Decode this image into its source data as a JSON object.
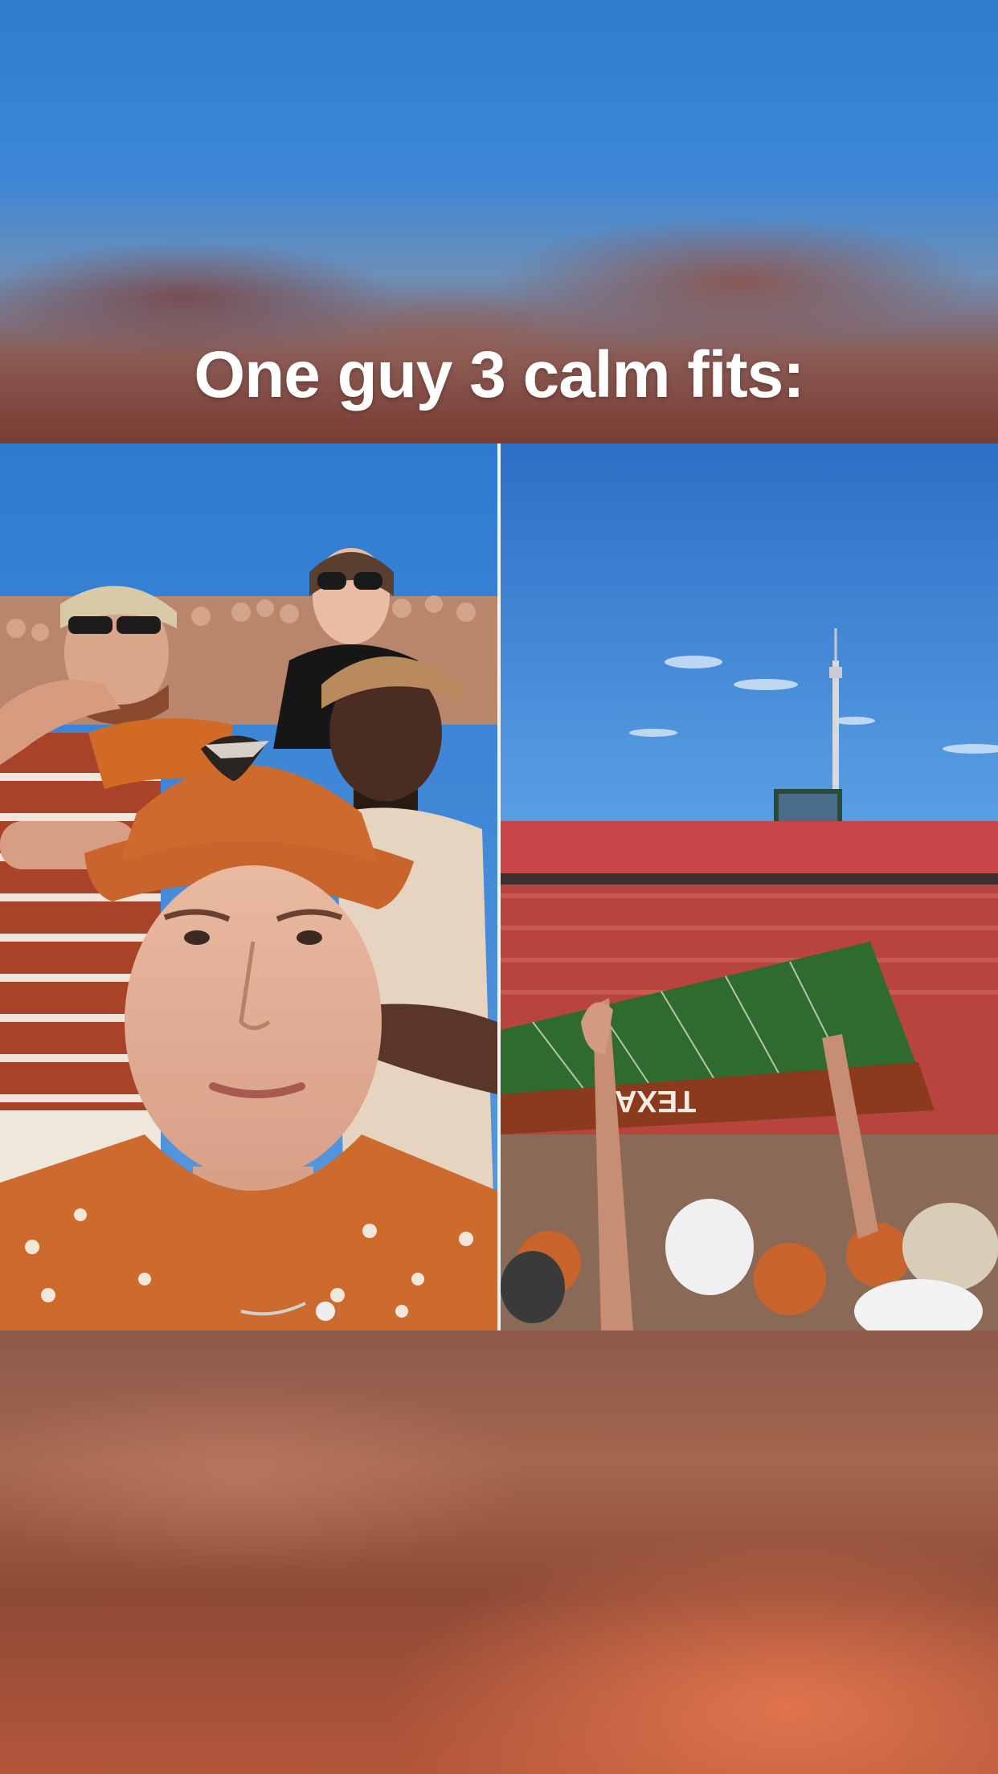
{
  "caption": "One guy 3 calm fits:",
  "photos": [
    {
      "subject": "selfie-in-stands"
    },
    {
      "subject": "stadium-field-view"
    }
  ],
  "field_text": "TEXAS",
  "colors": {
    "sky": "#3a86d8",
    "burnt_orange": "#c8642c",
    "field_green": "#2f6a2e",
    "crowd_red": "#b83a3a"
  }
}
